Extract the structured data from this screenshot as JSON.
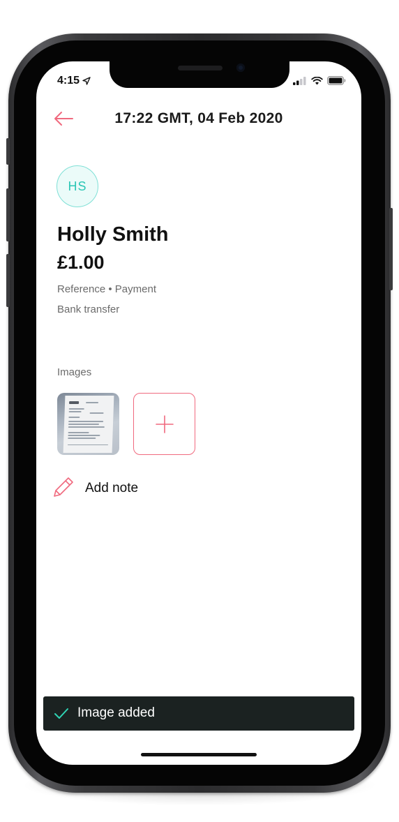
{
  "status_bar": {
    "time": "4:15"
  },
  "header": {
    "title": "17:22 GMT, 04 Feb 2020"
  },
  "transaction": {
    "avatar_initials": "HS",
    "payee_name": "Holly Smith",
    "amount": "£1.00",
    "reference_line": "Reference • Payment",
    "method": "Bank transfer"
  },
  "images": {
    "section_label": "Images"
  },
  "note": {
    "add_label": "Add note"
  },
  "toast": {
    "message": "Image added"
  },
  "colors": {
    "accent": "#f0697e",
    "avatar_text": "#2bc6b5",
    "toast_background": "#1b2221",
    "toast_check": "#2fd4b4"
  },
  "icons": {
    "back": "arrow-left-icon",
    "location": "location-arrow-icon",
    "signal": "cellular-signal-icon",
    "wifi": "wifi-icon",
    "battery": "battery-icon",
    "add": "plus-icon",
    "edit": "pencil-icon",
    "success": "checkmark-icon"
  }
}
